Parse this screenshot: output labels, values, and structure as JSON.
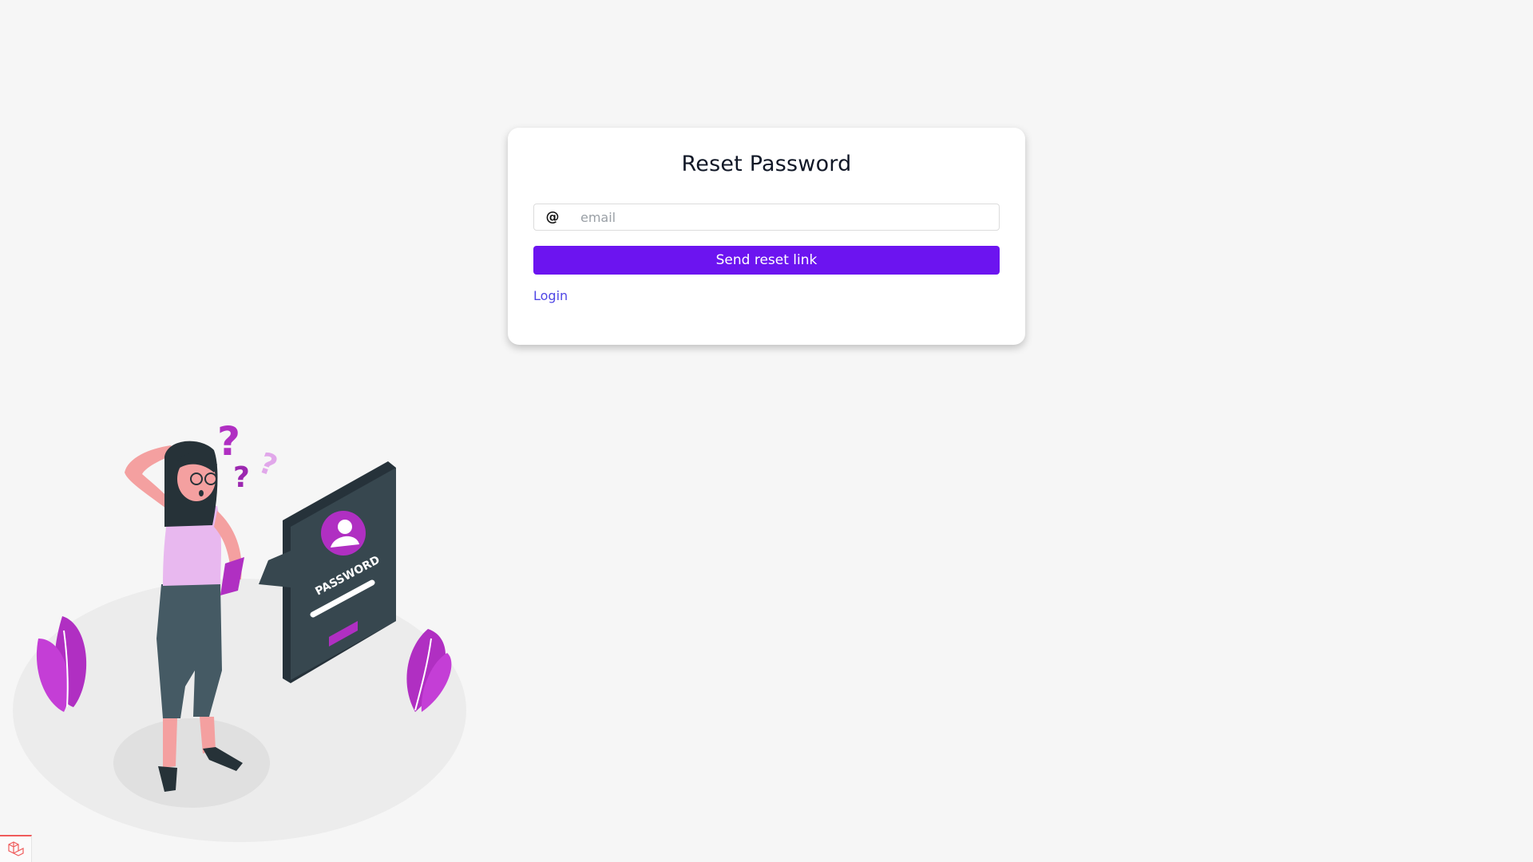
{
  "form": {
    "title": "Reset Password",
    "email_addon": "@",
    "email_placeholder": "email",
    "email_value": "",
    "submit_label": "Send reset link",
    "login_link": "Login"
  },
  "illustration": {
    "badge_text": "PASSWORD",
    "question_glyph": "?"
  },
  "colors": {
    "accent": "#6c14f0",
    "link": "#4f46e5",
    "illustration_purple": "#b02fc2",
    "illustration_dark": "#37474f"
  },
  "icons": {
    "corner_logo": "laravel-logo-icon"
  }
}
